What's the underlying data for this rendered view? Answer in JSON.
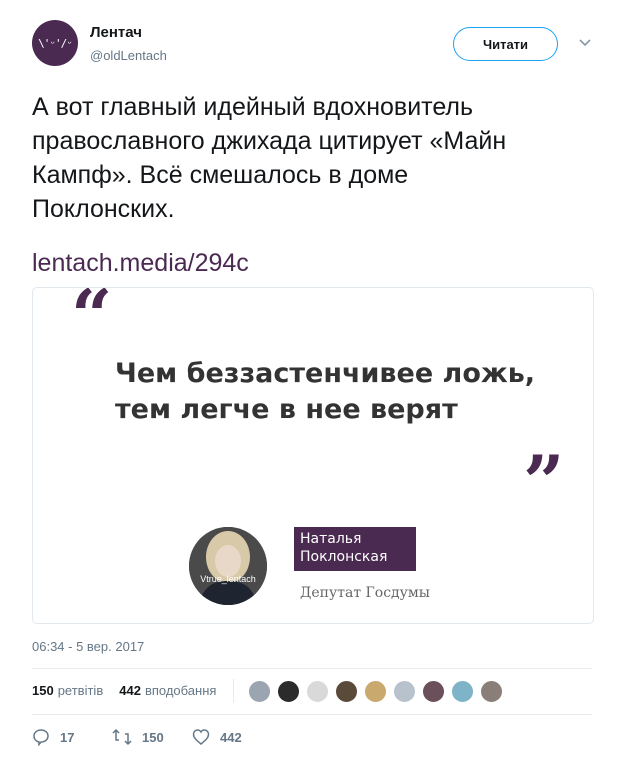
{
  "account": {
    "name": "Лентач",
    "handle": "@oldLentach",
    "avatar_text": "\\'ᵕ'/ᵕ"
  },
  "follow_button": {
    "label": "Читати"
  },
  "tweet": {
    "lines": [
      "А вот главный идейный вдохновитель",
      "православного джихада цитирует «Майн",
      "Кампф». Всё смешалось в доме",
      "Поклонских."
    ],
    "link": "lentach.media/294c"
  },
  "card": {
    "quote_open": "“",
    "quote_close": "”",
    "quote_lines": [
      "Чем беззастенчивее ложь,",
      "тем легче в нее верят"
    ],
    "person_name": [
      "Наталья",
      "Поклонская"
    ],
    "person_role": "Депутат Госдумы",
    "watermark": "Vtrue_lentach"
  },
  "timestamp": "06:34 - 5 вер. 2017",
  "stats": {
    "retweets_count": "150",
    "retweets_label": "ретвітів",
    "likes_count": "442",
    "likes_label": "вподобання"
  },
  "actions": {
    "reply_count": "17",
    "retweet_count": "150",
    "like_count": "442"
  },
  "colors": {
    "brand": "#4b2a52",
    "follow_border": "#1da1f2",
    "muted": "#657786"
  },
  "likers": [
    {
      "name": "liker-1",
      "color": "#9aa5b1"
    },
    {
      "name": "liker-2",
      "color": "#2b2b2b"
    },
    {
      "name": "liker-3",
      "color": "#d9d9d9"
    },
    {
      "name": "liker-4",
      "color": "#5a4a3a"
    },
    {
      "name": "liker-5",
      "color": "#c9a96e"
    },
    {
      "name": "liker-6",
      "color": "#b8c2cc"
    },
    {
      "name": "liker-7",
      "color": "#6b4f5a"
    },
    {
      "name": "liker-8",
      "color": "#7fb3c8"
    },
    {
      "name": "liker-9",
      "color": "#8a7f78"
    }
  ]
}
